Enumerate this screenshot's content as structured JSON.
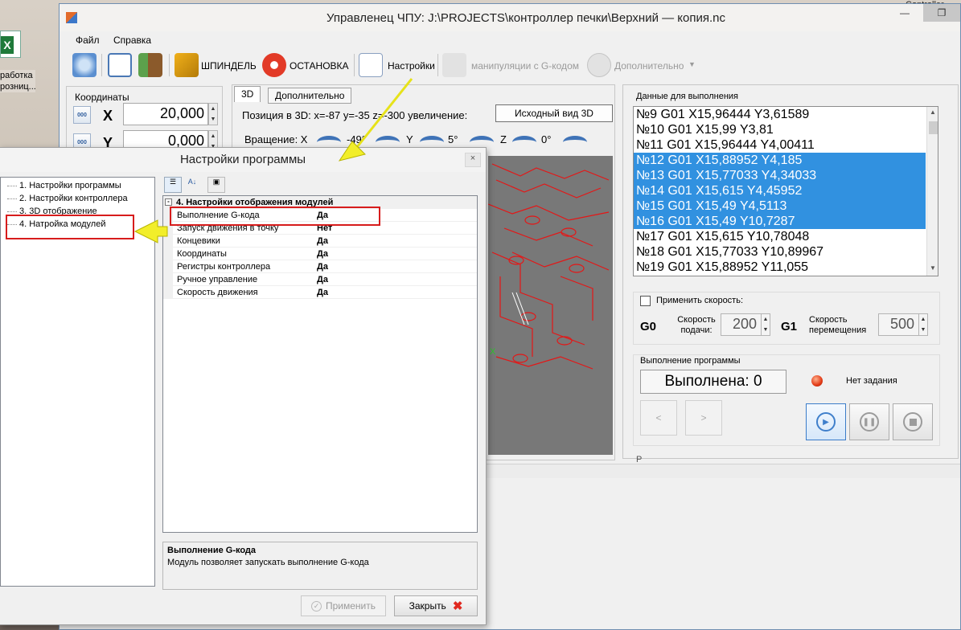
{
  "window": {
    "title": "Управленец ЧПУ: J:\\PROJECTS\\контроллер печки\\Верхний — копия.nc"
  },
  "menu": {
    "file": "Файл",
    "help": "Справка"
  },
  "toolbar": {
    "spindle": "ШПИНДЕЛЬ",
    "stop": "ОСТАНОВКА",
    "settings": "Настройки",
    "gcode_manip": "манипуляции с G-кодом",
    "additional": "Дополнительно"
  },
  "desktop": {
    "excel_label": "работка розниц...",
    "right_label": "Controller"
  },
  "coords": {
    "group_title": "Координаты",
    "btn_label": "000",
    "x_label": "X",
    "x_value": "20,000",
    "y_label": "Y",
    "y_value": "0,000"
  },
  "view3d": {
    "tab_3d": "3D",
    "tab_extra": "Дополнительно",
    "position_text": "Позиция в 3D: x=-87 y=-35 z=-300 увеличение:",
    "initial_view_btn": "Исходный вид 3D",
    "rotation_label": "Вращение: X",
    "rot_x": "-49°",
    "rot_y_label": "Y",
    "rot_y": "5°",
    "rot_z_label": "Z",
    "rot_z": "0°",
    "axis_x_label": "X"
  },
  "gcode": {
    "group_title": "Данные для выполнения",
    "lines": [
      {
        "text": "№9 G01 X15,96444 Y3,61589",
        "selected": false
      },
      {
        "text": "№10 G01 X15,99 Y3,81",
        "selected": false
      },
      {
        "text": "№11 G01 X15,96444 Y4,00411",
        "selected": false
      },
      {
        "text": "№12 G01 X15,88952 Y4,185",
        "selected": true
      },
      {
        "text": "№13 G01 X15,77033 Y4,34033",
        "selected": true
      },
      {
        "text": "№14 G01 X15,615 Y4,45952",
        "selected": true
      },
      {
        "text": "№15 G01 X15,49 Y4,5113",
        "selected": true
      },
      {
        "text": "№16 G01 X15,49 Y10,7287",
        "selected": true
      },
      {
        "text": "№17 G01 X15,615 Y10,78048",
        "selected": false
      },
      {
        "text": "№18 G01 X15,77033 Y10,89967",
        "selected": false
      },
      {
        "text": "№19 G01 X15,88952 Y11,055",
        "selected": false
      }
    ]
  },
  "speed": {
    "apply_label": "Применить скорость:",
    "g0": "G0",
    "feed_label": "Скорость подачи:",
    "feed_value": "200",
    "g1": "G1",
    "move_label": "Скорость перемещения",
    "move_value": "500"
  },
  "execution": {
    "group_title": "Выполнение программы",
    "status": "Выполнена: 0",
    "task": "Нет задания",
    "prev": "<",
    "next": ">",
    "bottom_partial": "Р"
  },
  "dialog": {
    "title": "Настройки программы",
    "close": "×",
    "tree": [
      "1. Настройки программы",
      "2. Настройки контроллера",
      "3. 3D отображение",
      "4. Натройка модулей"
    ],
    "category": "4. Настройки отображения модулей",
    "properties": [
      {
        "name": "Выполнение G-кода",
        "value": "Да"
      },
      {
        "name": "Запуск движения в точку",
        "value": "Нет"
      },
      {
        "name": "Концевики",
        "value": "Да"
      },
      {
        "name": "Координаты",
        "value": "Да"
      },
      {
        "name": "Регистры контроллера",
        "value": "Да"
      },
      {
        "name": "Ручное управление",
        "value": "Да"
      },
      {
        "name": "Скорость движения",
        "value": "Да"
      }
    ],
    "desc_title": "Выполнение G-кода",
    "desc_text": "Модуль позволяет запускать выполнение G-кода",
    "apply": "Применить",
    "close_btn": "Закрыть"
  },
  "colors": {
    "highlight": "#3191e0",
    "annotation_red": "#d71c1c",
    "annotation_yellow": "#f2ee2a"
  }
}
